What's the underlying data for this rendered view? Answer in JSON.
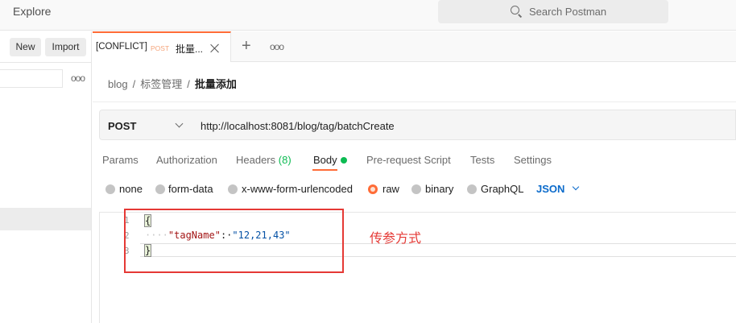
{
  "header": {
    "title": "Explore",
    "search_placeholder": "Search Postman"
  },
  "sidebar": {
    "new_label": "New",
    "import_label": "Import",
    "more_label": "ooo"
  },
  "tabs": {
    "active": {
      "prefix": "[CONFLICT]",
      "method": "POST",
      "name": "批量..."
    },
    "plus_label": "+",
    "more_label": "ooo"
  },
  "breadcrumb": {
    "items": [
      "blog",
      "标签管理"
    ],
    "current": "批量添加",
    "separator": "/"
  },
  "request": {
    "method": "POST",
    "url": "http://localhost:8081/blog/tag/batchCreate"
  },
  "request_tabs": [
    {
      "label": "Params"
    },
    {
      "label": "Authorization"
    },
    {
      "label": "Headers",
      "count": "(8)"
    },
    {
      "label": "Body"
    },
    {
      "label": "Pre-request Script"
    },
    {
      "label": "Tests"
    },
    {
      "label": "Settings"
    }
  ],
  "body_types": {
    "options": [
      "none",
      "form-data",
      "x-www-form-urlencoded",
      "raw",
      "binary",
      "GraphQL"
    ],
    "selected": "raw",
    "format": "JSON"
  },
  "editor": {
    "line_numbers": [
      "1",
      "2",
      "3"
    ],
    "line1": "{",
    "line2_indent": "····",
    "line2_key": "\"tagName\"",
    "line2_colon": ":·",
    "line2_value": "\"12,21,43\"",
    "line3": "}"
  },
  "annotation": {
    "text": "传参方式",
    "color": "#e53935"
  },
  "colors": {
    "accent": "#ff6c37",
    "success": "#0cbb52",
    "link": "#0b6bcb"
  }
}
